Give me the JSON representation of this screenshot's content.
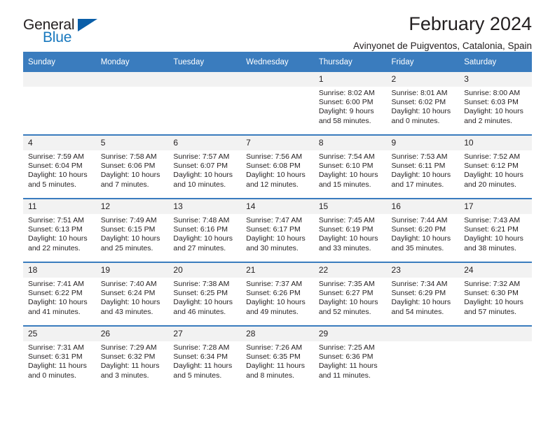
{
  "brand": {
    "name_part1": "General",
    "name_part2": "Blue",
    "logo_icon": "triangle-flag-icon"
  },
  "header": {
    "title": "February 2024",
    "subtitle": "Avinyonet de Puigventos, Catalonia, Spain"
  },
  "colors": {
    "header_blue": "#3a7cbe",
    "brand_blue": "#1878be",
    "logo_triangle": "#0a5ea8",
    "daynum_band": "#f2f2f2",
    "text": "#231f20"
  },
  "weekdays": [
    "Sunday",
    "Monday",
    "Tuesday",
    "Wednesday",
    "Thursday",
    "Friday",
    "Saturday"
  ],
  "weeks": [
    [
      {
        "day": "",
        "lines": []
      },
      {
        "day": "",
        "lines": []
      },
      {
        "day": "",
        "lines": []
      },
      {
        "day": "",
        "lines": []
      },
      {
        "day": "1",
        "lines": [
          "Sunrise: 8:02 AM",
          "Sunset: 6:00 PM",
          "Daylight: 9 hours",
          "and 58 minutes."
        ]
      },
      {
        "day": "2",
        "lines": [
          "Sunrise: 8:01 AM",
          "Sunset: 6:02 PM",
          "Daylight: 10 hours",
          "and 0 minutes."
        ]
      },
      {
        "day": "3",
        "lines": [
          "Sunrise: 8:00 AM",
          "Sunset: 6:03 PM",
          "Daylight: 10 hours",
          "and 2 minutes."
        ]
      }
    ],
    [
      {
        "day": "4",
        "lines": [
          "Sunrise: 7:59 AM",
          "Sunset: 6:04 PM",
          "Daylight: 10 hours",
          "and 5 minutes."
        ]
      },
      {
        "day": "5",
        "lines": [
          "Sunrise: 7:58 AM",
          "Sunset: 6:06 PM",
          "Daylight: 10 hours",
          "and 7 minutes."
        ]
      },
      {
        "day": "6",
        "lines": [
          "Sunrise: 7:57 AM",
          "Sunset: 6:07 PM",
          "Daylight: 10 hours",
          "and 10 minutes."
        ]
      },
      {
        "day": "7",
        "lines": [
          "Sunrise: 7:56 AM",
          "Sunset: 6:08 PM",
          "Daylight: 10 hours",
          "and 12 minutes."
        ]
      },
      {
        "day": "8",
        "lines": [
          "Sunrise: 7:54 AM",
          "Sunset: 6:10 PM",
          "Daylight: 10 hours",
          "and 15 minutes."
        ]
      },
      {
        "day": "9",
        "lines": [
          "Sunrise: 7:53 AM",
          "Sunset: 6:11 PM",
          "Daylight: 10 hours",
          "and 17 minutes."
        ]
      },
      {
        "day": "10",
        "lines": [
          "Sunrise: 7:52 AM",
          "Sunset: 6:12 PM",
          "Daylight: 10 hours",
          "and 20 minutes."
        ]
      }
    ],
    [
      {
        "day": "11",
        "lines": [
          "Sunrise: 7:51 AM",
          "Sunset: 6:13 PM",
          "Daylight: 10 hours",
          "and 22 minutes."
        ]
      },
      {
        "day": "12",
        "lines": [
          "Sunrise: 7:49 AM",
          "Sunset: 6:15 PM",
          "Daylight: 10 hours",
          "and 25 minutes."
        ]
      },
      {
        "day": "13",
        "lines": [
          "Sunrise: 7:48 AM",
          "Sunset: 6:16 PM",
          "Daylight: 10 hours",
          "and 27 minutes."
        ]
      },
      {
        "day": "14",
        "lines": [
          "Sunrise: 7:47 AM",
          "Sunset: 6:17 PM",
          "Daylight: 10 hours",
          "and 30 minutes."
        ]
      },
      {
        "day": "15",
        "lines": [
          "Sunrise: 7:45 AM",
          "Sunset: 6:19 PM",
          "Daylight: 10 hours",
          "and 33 minutes."
        ]
      },
      {
        "day": "16",
        "lines": [
          "Sunrise: 7:44 AM",
          "Sunset: 6:20 PM",
          "Daylight: 10 hours",
          "and 35 minutes."
        ]
      },
      {
        "day": "17",
        "lines": [
          "Sunrise: 7:43 AM",
          "Sunset: 6:21 PM",
          "Daylight: 10 hours",
          "and 38 minutes."
        ]
      }
    ],
    [
      {
        "day": "18",
        "lines": [
          "Sunrise: 7:41 AM",
          "Sunset: 6:22 PM",
          "Daylight: 10 hours",
          "and 41 minutes."
        ]
      },
      {
        "day": "19",
        "lines": [
          "Sunrise: 7:40 AM",
          "Sunset: 6:24 PM",
          "Daylight: 10 hours",
          "and 43 minutes."
        ]
      },
      {
        "day": "20",
        "lines": [
          "Sunrise: 7:38 AM",
          "Sunset: 6:25 PM",
          "Daylight: 10 hours",
          "and 46 minutes."
        ]
      },
      {
        "day": "21",
        "lines": [
          "Sunrise: 7:37 AM",
          "Sunset: 6:26 PM",
          "Daylight: 10 hours",
          "and 49 minutes."
        ]
      },
      {
        "day": "22",
        "lines": [
          "Sunrise: 7:35 AM",
          "Sunset: 6:27 PM",
          "Daylight: 10 hours",
          "and 52 minutes."
        ]
      },
      {
        "day": "23",
        "lines": [
          "Sunrise: 7:34 AM",
          "Sunset: 6:29 PM",
          "Daylight: 10 hours",
          "and 54 minutes."
        ]
      },
      {
        "day": "24",
        "lines": [
          "Sunrise: 7:32 AM",
          "Sunset: 6:30 PM",
          "Daylight: 10 hours",
          "and 57 minutes."
        ]
      }
    ],
    [
      {
        "day": "25",
        "lines": [
          "Sunrise: 7:31 AM",
          "Sunset: 6:31 PM",
          "Daylight: 11 hours",
          "and 0 minutes."
        ]
      },
      {
        "day": "26",
        "lines": [
          "Sunrise: 7:29 AM",
          "Sunset: 6:32 PM",
          "Daylight: 11 hours",
          "and 3 minutes."
        ]
      },
      {
        "day": "27",
        "lines": [
          "Sunrise: 7:28 AM",
          "Sunset: 6:34 PM",
          "Daylight: 11 hours",
          "and 5 minutes."
        ]
      },
      {
        "day": "28",
        "lines": [
          "Sunrise: 7:26 AM",
          "Sunset: 6:35 PM",
          "Daylight: 11 hours",
          "and 8 minutes."
        ]
      },
      {
        "day": "29",
        "lines": [
          "Sunrise: 7:25 AM",
          "Sunset: 6:36 PM",
          "Daylight: 11 hours",
          "and 11 minutes."
        ]
      },
      {
        "day": "",
        "lines": []
      },
      {
        "day": "",
        "lines": []
      }
    ]
  ]
}
